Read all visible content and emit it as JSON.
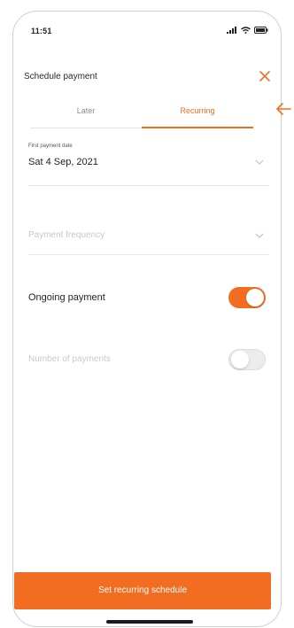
{
  "status_bar": {
    "time": "11:51"
  },
  "header": {
    "title": "Schedule payment"
  },
  "tabs": [
    {
      "label": "Later",
      "active": false
    },
    {
      "label": "Recurring",
      "active": true
    }
  ],
  "first_payment_date": {
    "label": "First payment date",
    "value": "Sat 4 Sep, 2021"
  },
  "payment_frequency": {
    "placeholder": "Payment frequency"
  },
  "ongoing_payment": {
    "label": "Ongoing payment",
    "enabled": true
  },
  "number_of_payments": {
    "label": "Number of payments",
    "enabled": false
  },
  "cta": {
    "label": "Set recurring schedule"
  },
  "colors": {
    "accent": "#f26d21",
    "text": "#1f1f1f",
    "muted": "#c8c8c8"
  },
  "icons": [
    "signal-icon",
    "wifi-icon",
    "battery-icon",
    "close-icon",
    "chevron-down-icon",
    "left-arrow-icon"
  ]
}
